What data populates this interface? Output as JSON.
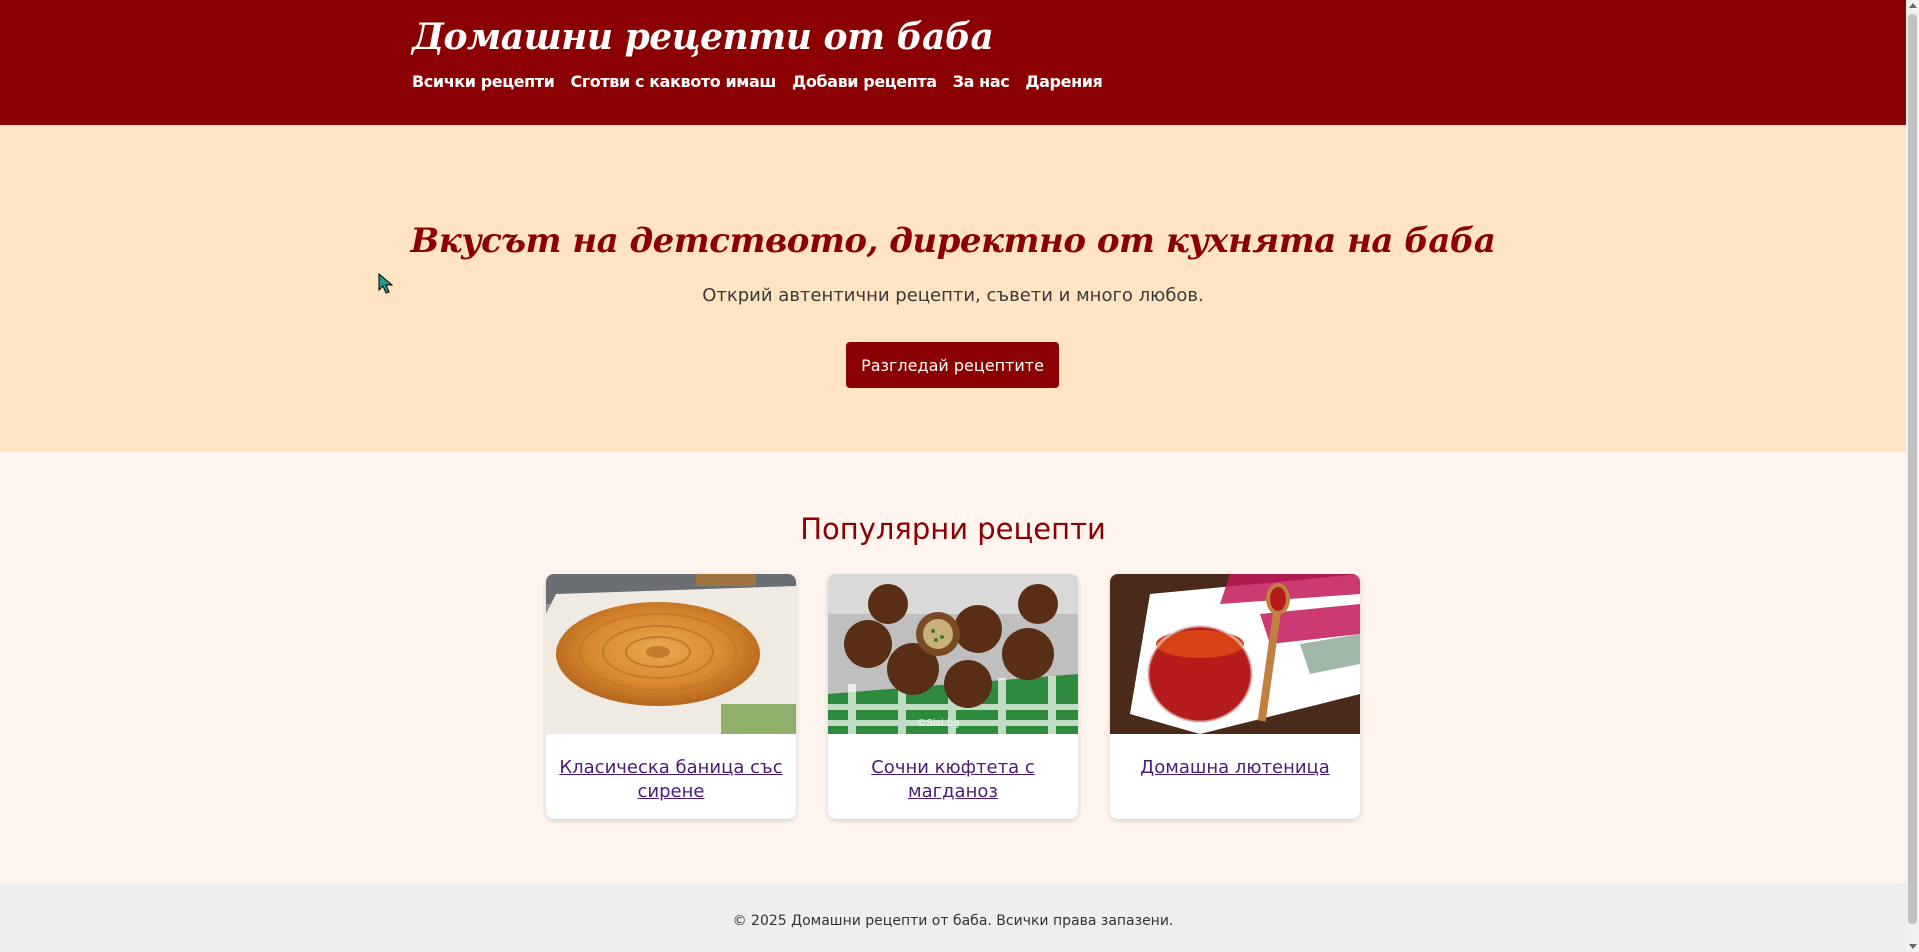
{
  "header": {
    "logo": "Домашни рецепти от баба",
    "nav": [
      "Всички рецепти",
      "Сготви с каквото имаш",
      "Добави рецепта",
      "За нас",
      "Дарения"
    ]
  },
  "hero": {
    "title": "Вкусът на детството, директно от кухнята на баба",
    "subtitle": "Открий автентични рецепти, съвети и много любов.",
    "button": "Разгледай рецептите"
  },
  "popular": {
    "title": "Популярни рецепти",
    "cards": [
      {
        "title": "Класическа баница със сирене",
        "image_icon": "banitsa-photo"
      },
      {
        "title": "Сочни кюфтета с магданоз",
        "image_icon": "meatballs-photo",
        "watermark": "©Sisi.bg"
      },
      {
        "title": "Домашна лютеница",
        "image_icon": "lyutenitsa-photo"
      }
    ]
  },
  "footer": {
    "text": "© 2025 Домашни рецепти от баба. Всички права запазени."
  },
  "colors": {
    "brand": "#8b0000",
    "hero_bg": "#ffe4c4",
    "section_bg": "#fff5ee",
    "footer_bg": "#eeeeee",
    "link": "#4b1c7a"
  }
}
